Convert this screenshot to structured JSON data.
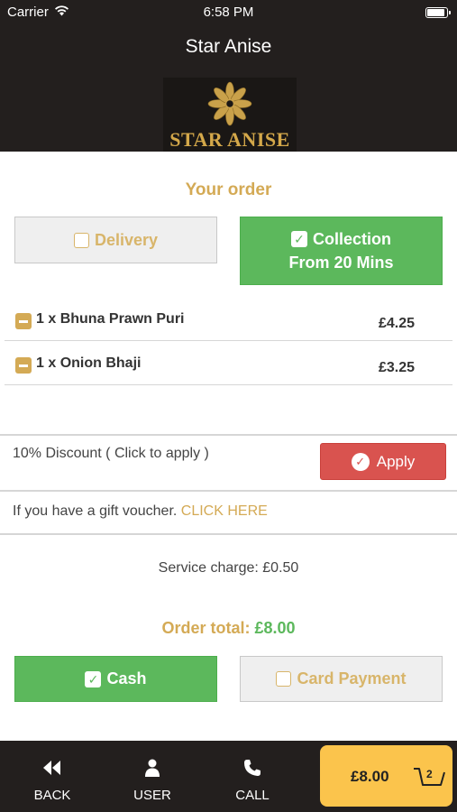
{
  "status_bar": {
    "carrier": "Carrier",
    "time": "6:58 PM"
  },
  "header": {
    "title": "Star Anise",
    "logo_text": "STAR ANISE"
  },
  "order": {
    "heading": "Your order",
    "delivery_label": "Delivery",
    "collection_label": "Collection",
    "collection_sub": "From 20 Mins",
    "items": [
      {
        "name": "1 x Bhuna Prawn Puri",
        "price": "£4.25"
      },
      {
        "name": "1 x Onion Bhaji",
        "price": "£3.25"
      }
    ]
  },
  "discount": {
    "text": "10% Discount ( Click to apply )",
    "apply_label": "Apply"
  },
  "voucher": {
    "text": "If you have a gift voucher. ",
    "link": "CLICK HERE"
  },
  "service_charge": "Service charge: £0.50",
  "total": {
    "label": "Order total: ",
    "amount": "£8.00"
  },
  "payment": {
    "cash_label": "Cash",
    "card_label": "Card Payment"
  },
  "tabbar": {
    "back": "BACK",
    "user": "USER",
    "call": "CALL",
    "cart_total": "£8.00",
    "cart_count": "2"
  },
  "colors": {
    "gold": "#d4aa55",
    "green": "#5cb85c",
    "red": "#d9534f",
    "dark": "#231f1e",
    "cart": "#fbc44c"
  },
  "icons": [
    "wifi-icon",
    "battery-icon",
    "star-anise-logo",
    "checkbox-icon",
    "minus-icon",
    "check-circle-icon",
    "back-icon",
    "user-icon",
    "phone-icon",
    "basket-icon"
  ]
}
